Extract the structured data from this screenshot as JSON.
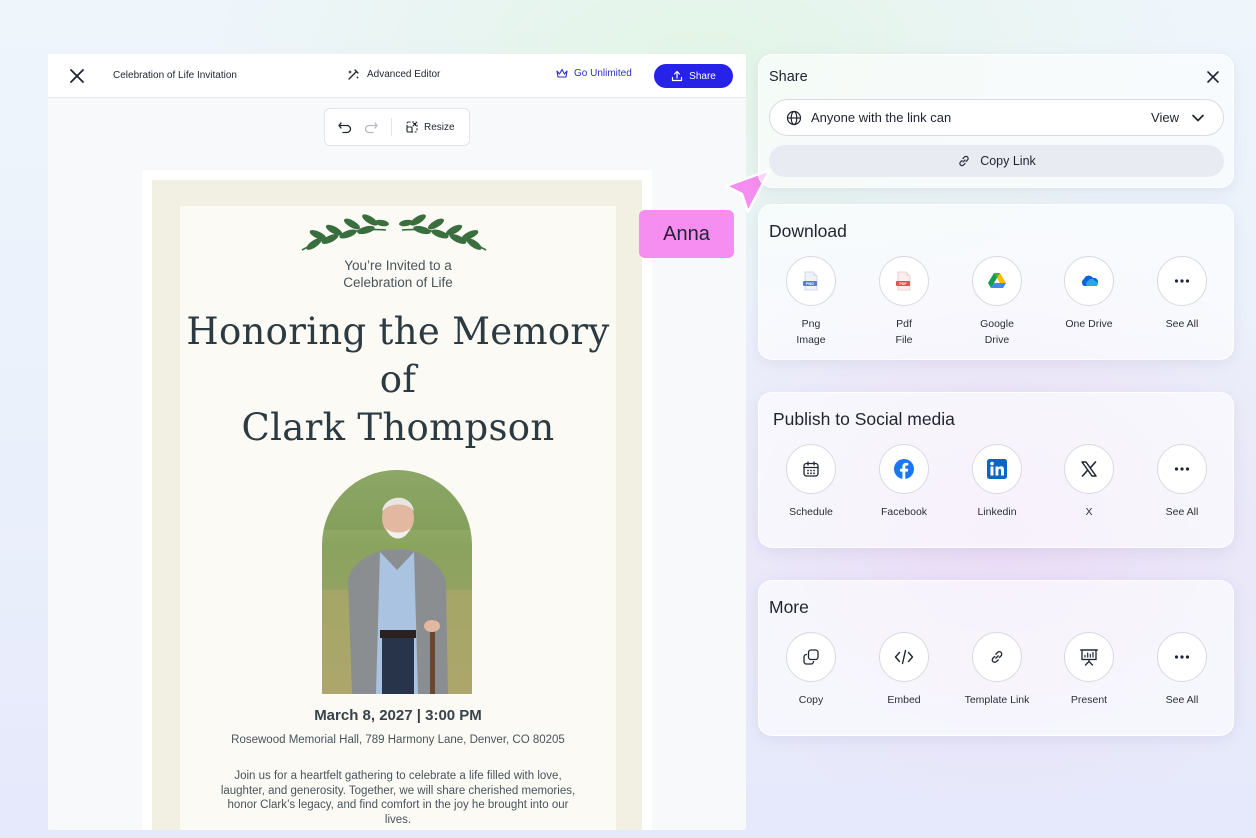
{
  "editor": {
    "doc_title": "Celebration of Life Invitation",
    "advanced_editor": "Advanced Editor",
    "go_unlimited": "Go Unlimited",
    "share": "Share",
    "resize": "Resize"
  },
  "invitation": {
    "invited_line1": "You’re Invited to a",
    "invited_line2": "Celebration of Life",
    "title_line1": "Honoring the Memory",
    "title_line2": "of",
    "title_line3": "Clark Thompson",
    "date": "March 8, 2027 | 3:00 PM",
    "venue": "Rosewood Memorial Hall, 789 Harmony Lane, Denver, CO 80205",
    "description": "Join us for a heartfelt gathering to celebrate a life filled with love, laughter, and generosity. Together, we will share cherished memories, honor Clark’s legacy, and find comfort in the joy he brought into our lives."
  },
  "collaborator": {
    "name": "Anna",
    "color": "#f58ef0"
  },
  "share_panel": {
    "title": "Share",
    "access_label": "Anyone with the link can",
    "access_value": "View",
    "copy_link": "Copy Link"
  },
  "download": {
    "title": "Download",
    "items": [
      {
        "label": "Png\nImage",
        "icon": "png-file-icon"
      },
      {
        "label": "Pdf\nFile",
        "icon": "pdf-file-icon"
      },
      {
        "label": "Google\nDrive",
        "icon": "google-drive-icon"
      },
      {
        "label": "One Drive",
        "icon": "onedrive-icon"
      },
      {
        "label": "See All",
        "icon": "more-dots-icon"
      }
    ]
  },
  "social": {
    "title": "Publish to Social media",
    "items": [
      {
        "label": "Schedule",
        "icon": "calendar-icon"
      },
      {
        "label": "Facebook",
        "icon": "facebook-icon"
      },
      {
        "label": "Linkedin",
        "icon": "linkedin-icon"
      },
      {
        "label": "X",
        "icon": "x-icon"
      },
      {
        "label": "See All",
        "icon": "more-dots-icon"
      }
    ]
  },
  "more": {
    "title": "More",
    "items": [
      {
        "label": "Copy",
        "icon": "copy-icon"
      },
      {
        "label": "Embed",
        "icon": "code-icon"
      },
      {
        "label": "Template Link",
        "icon": "link-icon"
      },
      {
        "label": "Present",
        "icon": "presentation-icon"
      },
      {
        "label": "See All",
        "icon": "more-dots-icon"
      }
    ]
  },
  "colors": {
    "accent": "#2622e8",
    "go_unlimited": "#2c2ec9",
    "card_frame": "#f2f0e2",
    "title_text": "#2c3a42"
  }
}
